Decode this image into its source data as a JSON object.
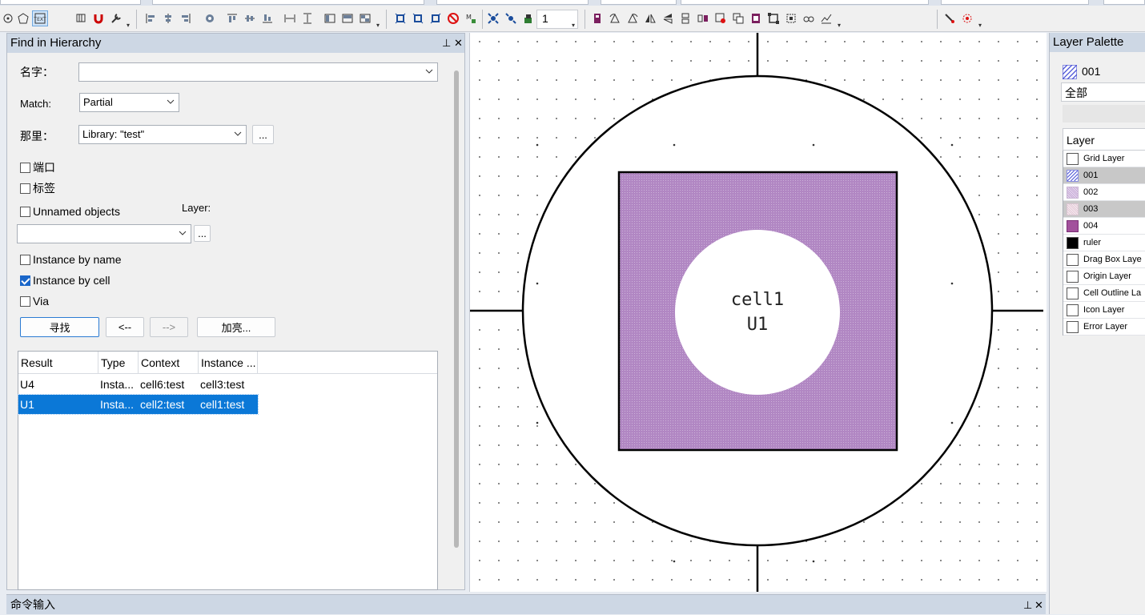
{
  "find_panel": {
    "title": "Find in Hierarchy",
    "pin_glyph": "⊥",
    "close_glyph": "✕",
    "name_label": "名字：",
    "name_value": "",
    "match_label": "Match:",
    "match_value": "Partial",
    "where_label": "那里：",
    "where_value": "Library: \"test\"",
    "ellipsis": "...",
    "checkbox_port": {
      "label": "端口",
      "checked": false
    },
    "checkbox_label": {
      "label": "标签",
      "checked": false
    },
    "checkbox_unnamed": {
      "label": "Unnamed objects",
      "checked": false
    },
    "layer_label": "Layer:",
    "layer_value": "",
    "checkbox_instance_name": {
      "label": "Instance by name",
      "checked": false
    },
    "checkbox_instance_cell": {
      "label": "Instance by cell",
      "checked": true
    },
    "checkbox_via": {
      "label": "Via",
      "checked": false
    },
    "btn_find": "寻找",
    "btn_prev": "<--",
    "btn_next": "-->",
    "btn_highlight": "加亮...",
    "results": {
      "columns": [
        "Result",
        "Type",
        "Context",
        "Instance ..."
      ],
      "rows": [
        {
          "result": "U4",
          "type": "Insta...",
          "context": "cell6:test",
          "instance": "cell3:test",
          "selected": false
        },
        {
          "result": "U1",
          "type": "Insta...",
          "context": "cell2:test",
          "instance": "cell1:test",
          "selected": true
        }
      ]
    }
  },
  "toolbar": {
    "number_value": "1"
  },
  "canvas": {
    "cell_name": "cell1",
    "instance_name": "U1",
    "fill_color": "#b187c3"
  },
  "layer_palette": {
    "title": "Layer Palette",
    "current_layer": "001",
    "filter": "全部",
    "header": "Layer",
    "layers": [
      {
        "name": "Grid Layer",
        "swatch": "empty",
        "highlighted": false
      },
      {
        "name": "001",
        "swatch": "hatch-blue",
        "highlighted": true
      },
      {
        "name": "002",
        "swatch": "dots-purple",
        "highlighted": false
      },
      {
        "name": "003",
        "swatch": "dots-pink",
        "highlighted": true
      },
      {
        "name": "004",
        "swatch": "solid-purple",
        "highlighted": false
      },
      {
        "name": "ruler",
        "swatch": "solid-black",
        "highlighted": false
      },
      {
        "name": "Drag Box Laye",
        "swatch": "empty",
        "highlighted": false
      },
      {
        "name": "Origin Layer",
        "swatch": "empty",
        "highlighted": false
      },
      {
        "name": "Cell Outline La",
        "swatch": "empty",
        "highlighted": false
      },
      {
        "name": "Icon Layer",
        "swatch": "empty",
        "highlighted": false
      },
      {
        "name": "Error Layer",
        "swatch": "empty",
        "highlighted": false
      }
    ]
  },
  "command_bar": {
    "title": "命令输入"
  }
}
